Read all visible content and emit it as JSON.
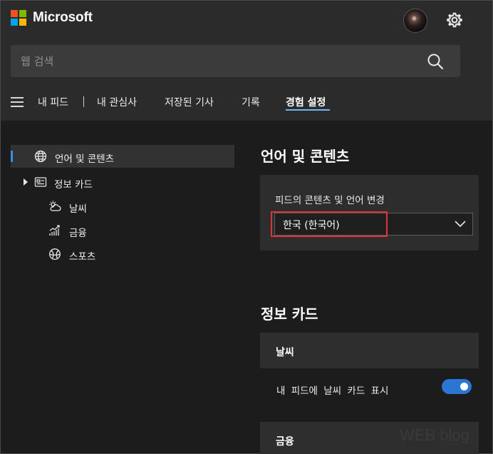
{
  "brand": {
    "name": "Microsoft",
    "logo_colors": [
      "#f25022",
      "#7fba00",
      "#00a4ef",
      "#ffb900"
    ]
  },
  "header": {
    "avatar_icon": "avatar",
    "settings_icon": "gear-icon"
  },
  "search": {
    "placeholder": "웹 검색",
    "icon": "search-icon"
  },
  "nav": {
    "items": [
      {
        "label": "내 피드"
      },
      {
        "label": "내 관심사"
      },
      {
        "label": "저장된 기사"
      },
      {
        "label": "기록"
      },
      {
        "label": "경험 설정",
        "active": true
      }
    ],
    "accent": "#6fb5ff"
  },
  "sidebar": {
    "items": [
      {
        "label": "언어 및 콘텐츠",
        "icon": "globe-icon",
        "selected": true
      },
      {
        "label": "정보 카드",
        "icon": "card-icon",
        "expandable": true
      },
      {
        "label": "날씨",
        "icon": "weather-icon"
      },
      {
        "label": "금융",
        "icon": "finance-icon"
      },
      {
        "label": "스포츠",
        "icon": "sports-icon"
      }
    ]
  },
  "language_section": {
    "title": "언어 및 콘텐츠",
    "field_label": "피드의 콘텐츠 및 언어 변경",
    "selected_value": "한국 (한국어)"
  },
  "info_cards_section": {
    "title": "정보 카드",
    "weather": {
      "title": "날씨",
      "toggle_label": "내 피드에 날씨 카드 표시",
      "toggle_on": true
    },
    "finance": {
      "title": "금융"
    }
  },
  "colors": {
    "toggle_on": "#2b76d2",
    "highlight": "#e0323a",
    "selection_bar": "#3a8ee6"
  },
  "watermark": "WEB blog"
}
